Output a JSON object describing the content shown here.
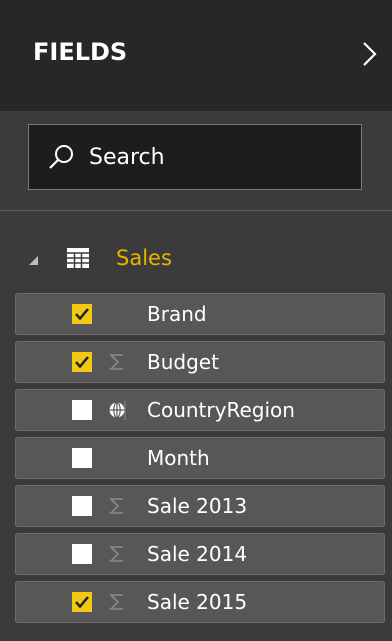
{
  "header": {
    "title": "FIELDS",
    "collapse_icon": "chevron-right-icon"
  },
  "search": {
    "placeholder": "Search",
    "icon": "search-icon"
  },
  "table": {
    "name": "Sales",
    "icon": "table-grid-icon",
    "expand_icon": "expanded-triangle-icon",
    "name_color": "#e8b400"
  },
  "fields": [
    {
      "label": "Brand",
      "checked": true,
      "type_icon": "none"
    },
    {
      "label": "Budget",
      "checked": true,
      "type_icon": "sigma-icon"
    },
    {
      "label": "CountryRegion",
      "checked": false,
      "type_icon": "globe-icon"
    },
    {
      "label": "Month",
      "checked": false,
      "type_icon": "none"
    },
    {
      "label": "Sale 2013",
      "checked": false,
      "type_icon": "sigma-icon"
    },
    {
      "label": "Sale 2014",
      "checked": false,
      "type_icon": "sigma-icon"
    },
    {
      "label": "Sale 2015",
      "checked": true,
      "type_icon": "sigma-icon"
    }
  ],
  "colors": {
    "accent": "#f2c811",
    "panel_bg": "#3b3b3b",
    "header_bg": "#272727",
    "item_bg": "#575757"
  }
}
